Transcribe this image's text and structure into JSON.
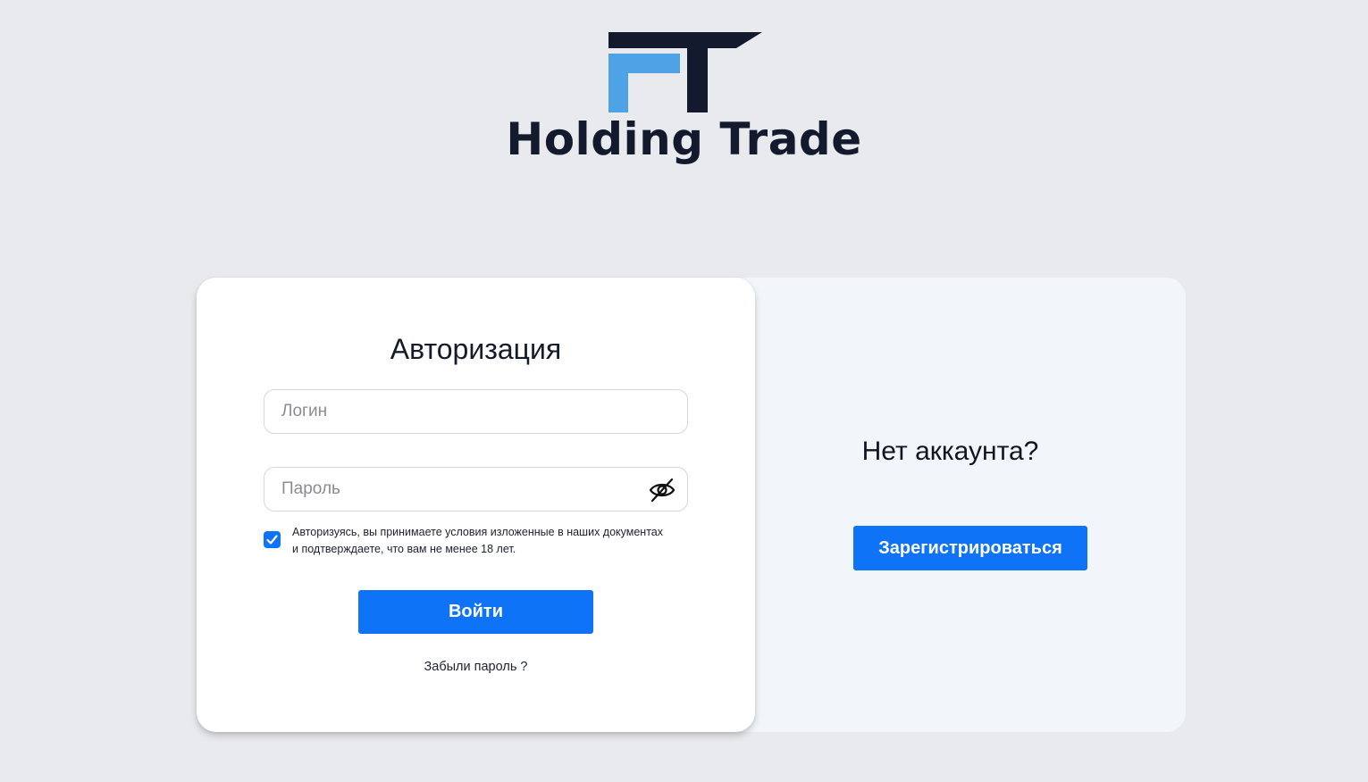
{
  "brand": {
    "name": "Holding Trade",
    "colors": {
      "dark": "#131a2e",
      "light_blue": "#4ea3e6"
    }
  },
  "login": {
    "title": "Авторизация",
    "login_placeholder": "Логин",
    "login_value": "",
    "password_placeholder": "Пароль",
    "password_value": "",
    "password_toggle_icon": "eye-slash-icon",
    "consent_checked": true,
    "consent_line1": "Авторизуясь, вы принимаете условия изложенные в наших документах",
    "consent_line2": "и подтверждаете, что вам не менее 18 лет.",
    "submit_label": "Войти",
    "forgot_label": "Забыли пароль ?"
  },
  "register": {
    "title": "Нет аккаунта?",
    "button_label": "Зарегистрироваться"
  },
  "colors": {
    "accent": "#0e73f6",
    "page_background": "#e9eaee",
    "right_panel": "#f2f5f9"
  }
}
